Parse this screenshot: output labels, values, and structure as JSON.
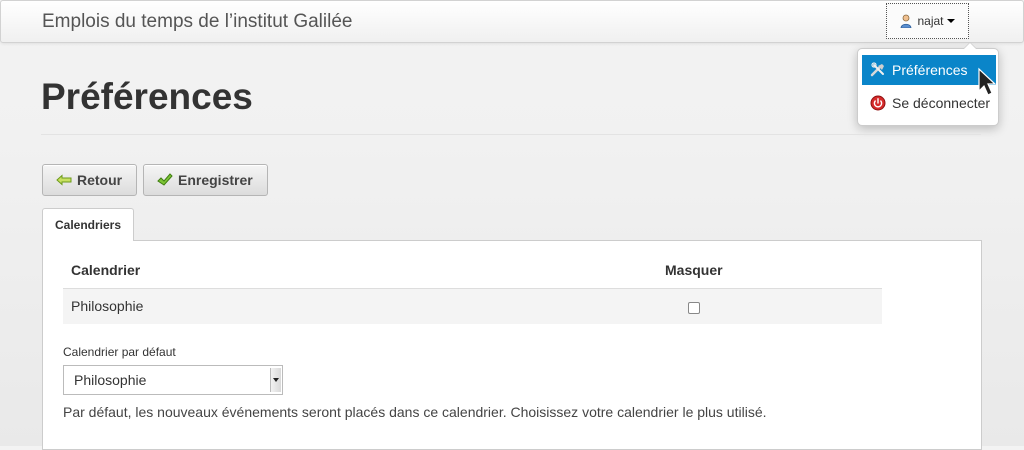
{
  "navbar": {
    "brand": "Emplois du temps de l’institut Galilée",
    "user_name": "najat"
  },
  "user_menu": {
    "items": [
      {
        "label": "Préférences",
        "icon": "tools-icon",
        "active": true
      },
      {
        "label": "Se déconnecter",
        "icon": "power-icon",
        "active": false
      }
    ],
    "active_color": "#0a85c9"
  },
  "page": {
    "title": "Préférences"
  },
  "toolbar": {
    "back_label": "Retour",
    "save_label": "Enregistrer"
  },
  "tabs": [
    {
      "label": "Calendriers",
      "active": true
    }
  ],
  "calendars_table": {
    "headers": [
      "Calendrier",
      "Masquer"
    ],
    "rows": [
      {
        "name": "Philosophie",
        "hidden": false
      }
    ]
  },
  "default_calendar": {
    "label": "Calendrier par défaut",
    "selected": "Philosophie",
    "help": "Par défaut, les nouveaux événements seront placés dans ce calendrier. Choisissez votre calendrier le plus utilisé."
  }
}
